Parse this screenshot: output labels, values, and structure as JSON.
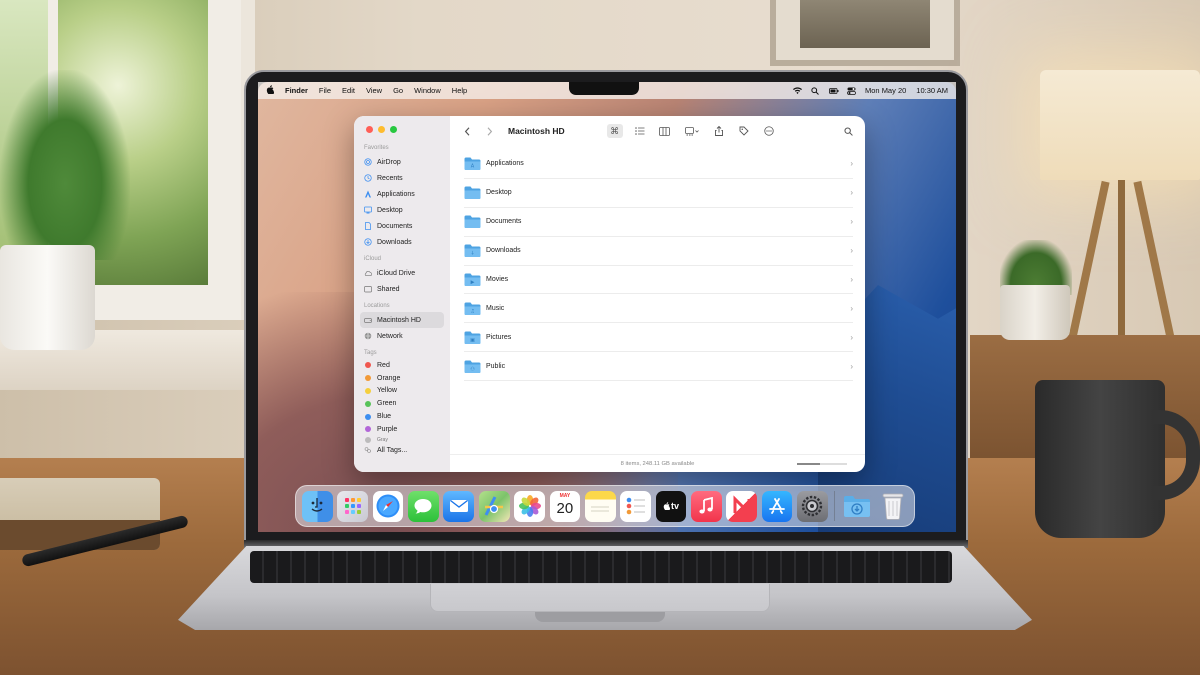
{
  "menubar": {
    "app": "Finder",
    "menus": [
      "File",
      "Edit",
      "View",
      "Go",
      "Window",
      "Help"
    ],
    "date": "Mon May 20",
    "time": "10:30 AM",
    "icons": [
      "wifi-icon",
      "search-icon",
      "battery-icon",
      "control-center-icon"
    ]
  },
  "finder": {
    "title": "Macintosh HD",
    "sidebar": {
      "favorites_title": "Favorites",
      "favorites": [
        "AirDrop",
        "Recents",
        "Applications",
        "Desktop",
        "Documents",
        "Downloads"
      ],
      "icloud_title": "iCloud",
      "icloud": [
        "iCloud Drive",
        "Shared"
      ],
      "locations_title": "Locations",
      "locations": [
        "Macintosh HD",
        "Network"
      ],
      "tags_title": "Tags",
      "tags": [
        {
          "label": "Red",
          "color": "#f0574f"
        },
        {
          "label": "Orange",
          "color": "#f29a38"
        },
        {
          "label": "Yellow",
          "color": "#f5cf3d"
        },
        {
          "label": "Green",
          "color": "#58c35a"
        },
        {
          "label": "Blue",
          "color": "#3d8ef0"
        },
        {
          "label": "Purple",
          "color": "#b266d8"
        },
        {
          "label": "Gray",
          "color": "#9d9d9d"
        }
      ],
      "all_tags": "All Tags..."
    },
    "folders": [
      "Applications",
      "Desktop",
      "Documents",
      "Downloads",
      "Movies",
      "Music",
      "Pictures",
      "Public"
    ],
    "status": "8 items, 248.11 GB available",
    "icon_size_fraction": 0.45
  },
  "dock": {
    "apps": [
      "Finder",
      "Launchpad",
      "Safari",
      "Messages",
      "Mail",
      "Maps",
      "Photos",
      "Calendar",
      "Notes",
      "Reminders",
      "Apple TV",
      "Music",
      "News",
      "App Store",
      "System Settings"
    ],
    "calendar_month": "MAY",
    "calendar_day": "20",
    "tv_label": "tv",
    "extras": [
      "Downloads folder",
      "Trash"
    ]
  },
  "colors": {
    "accent": "#3d8ef0",
    "folder_blue": "#5aaee8",
    "traffic_red": "#ff5f57",
    "traffic_yellow": "#febc2e",
    "traffic_green": "#28c840"
  }
}
